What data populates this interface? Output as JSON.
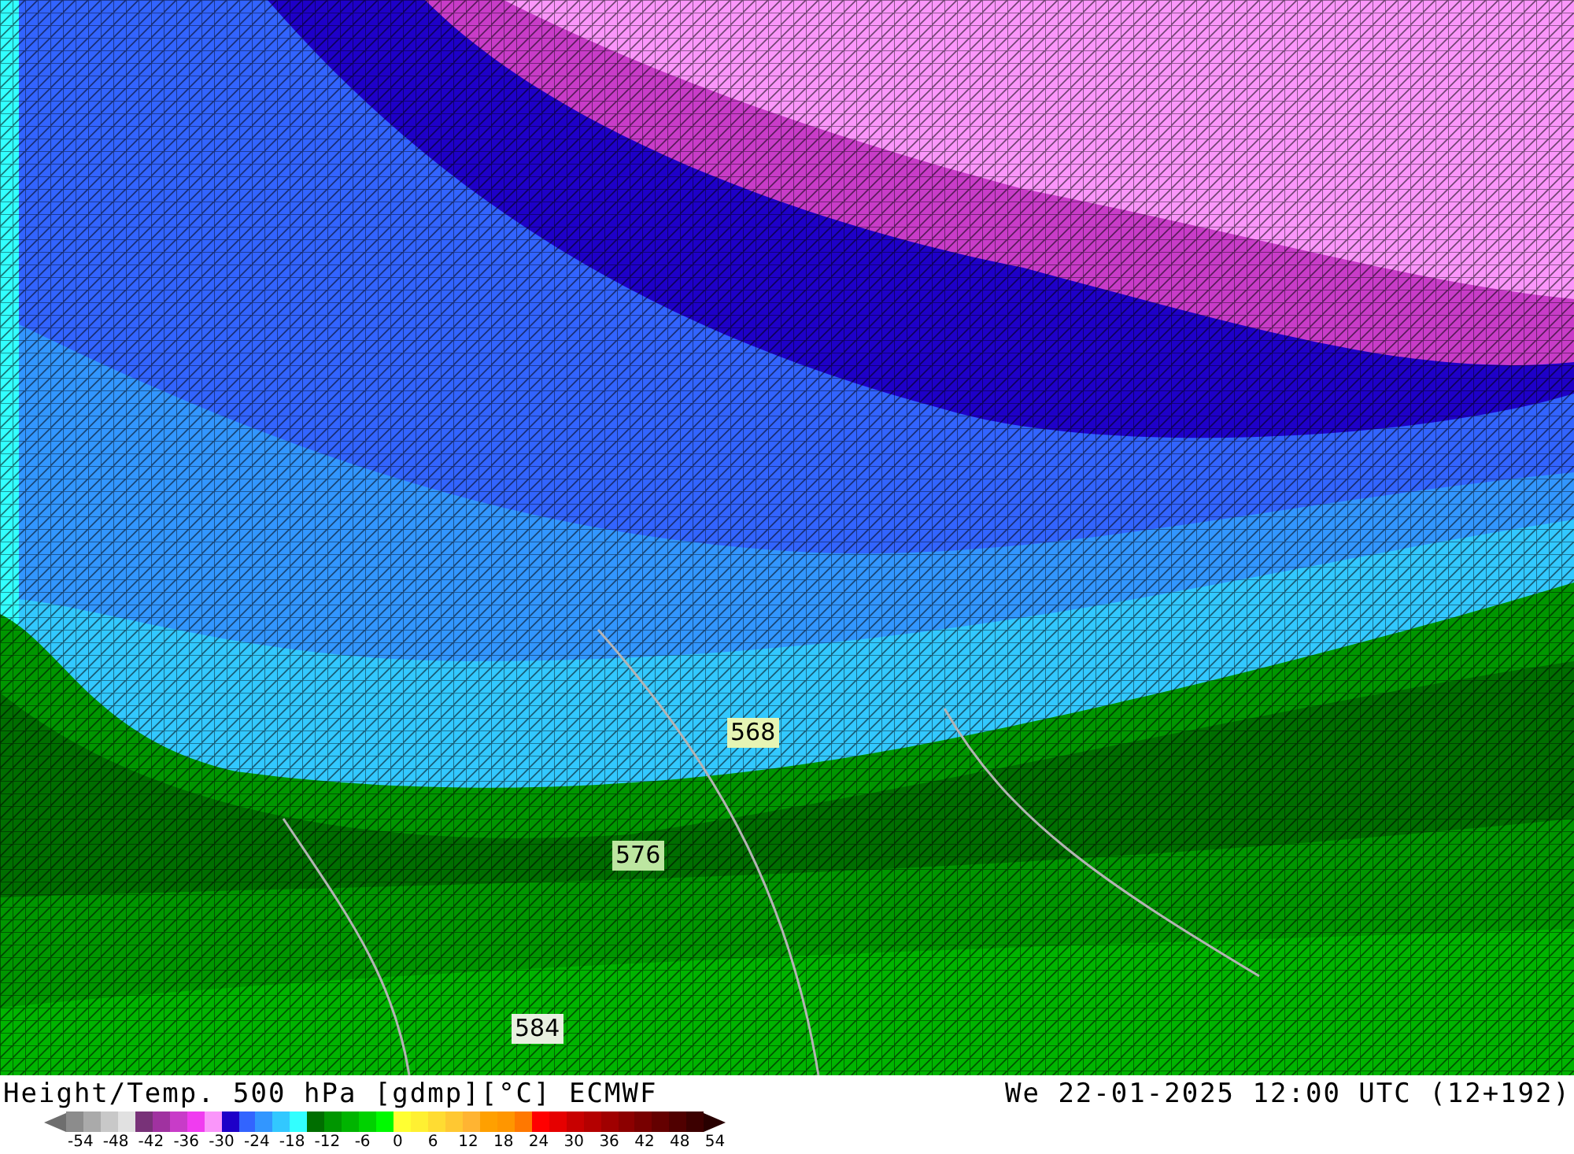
{
  "map": {
    "contour_labels": [
      {
        "text": "568",
        "color": "#e6f5b4"
      },
      {
        "text": "576",
        "color": "#bce6a0"
      },
      {
        "text": "584",
        "color": "#e8f0e0"
      }
    ]
  },
  "title": "Height/Temp. 500 hPa [gdmp][°C] ECMWF",
  "valid_time": "We 22-01-2025 12:00 UTC (12+192)",
  "colorbar": {
    "swatches": [
      {
        "color": "#8c8c8c"
      },
      {
        "color": "#aaaaaa"
      },
      {
        "color": "#c8c8c8"
      },
      {
        "color": "#e1e1e1"
      },
      {
        "color": "#783278"
      },
      {
        "color": "#a032a0"
      },
      {
        "color": "#c83cc8"
      },
      {
        "color": "#f03cf0"
      },
      {
        "color": "#fa96fa"
      },
      {
        "color": "#1e00c8"
      },
      {
        "color": "#3264ff"
      },
      {
        "color": "#3296ff"
      },
      {
        "color": "#32c8ff"
      },
      {
        "color": "#32ffff"
      },
      {
        "color": "#006e00"
      },
      {
        "color": "#009600"
      },
      {
        "color": "#00b400"
      },
      {
        "color": "#00d200"
      },
      {
        "color": "#00fa00"
      },
      {
        "color": "#ffff32"
      },
      {
        "color": "#fff032"
      },
      {
        "color": "#ffdc32"
      },
      {
        "color": "#ffc832"
      },
      {
        "color": "#ffb432"
      },
      {
        "color": "#ffa000"
      },
      {
        "color": "#ff9600"
      },
      {
        "color": "#ff7800"
      },
      {
        "color": "#ff0000"
      },
      {
        "color": "#e60000"
      },
      {
        "color": "#c80000"
      },
      {
        "color": "#b40000"
      },
      {
        "color": "#a00000"
      },
      {
        "color": "#8c0000"
      },
      {
        "color": "#780000"
      },
      {
        "color": "#640000"
      },
      {
        "color": "#500000"
      },
      {
        "color": "#3c0000"
      }
    ],
    "ticks": [
      "-54",
      "-48",
      "-42",
      "-36",
      "-30",
      "-24",
      "-18",
      "-12",
      "-6",
      "0",
      "6",
      "12",
      "18",
      "24",
      "30",
      "36",
      "42",
      "48",
      "54"
    ]
  }
}
